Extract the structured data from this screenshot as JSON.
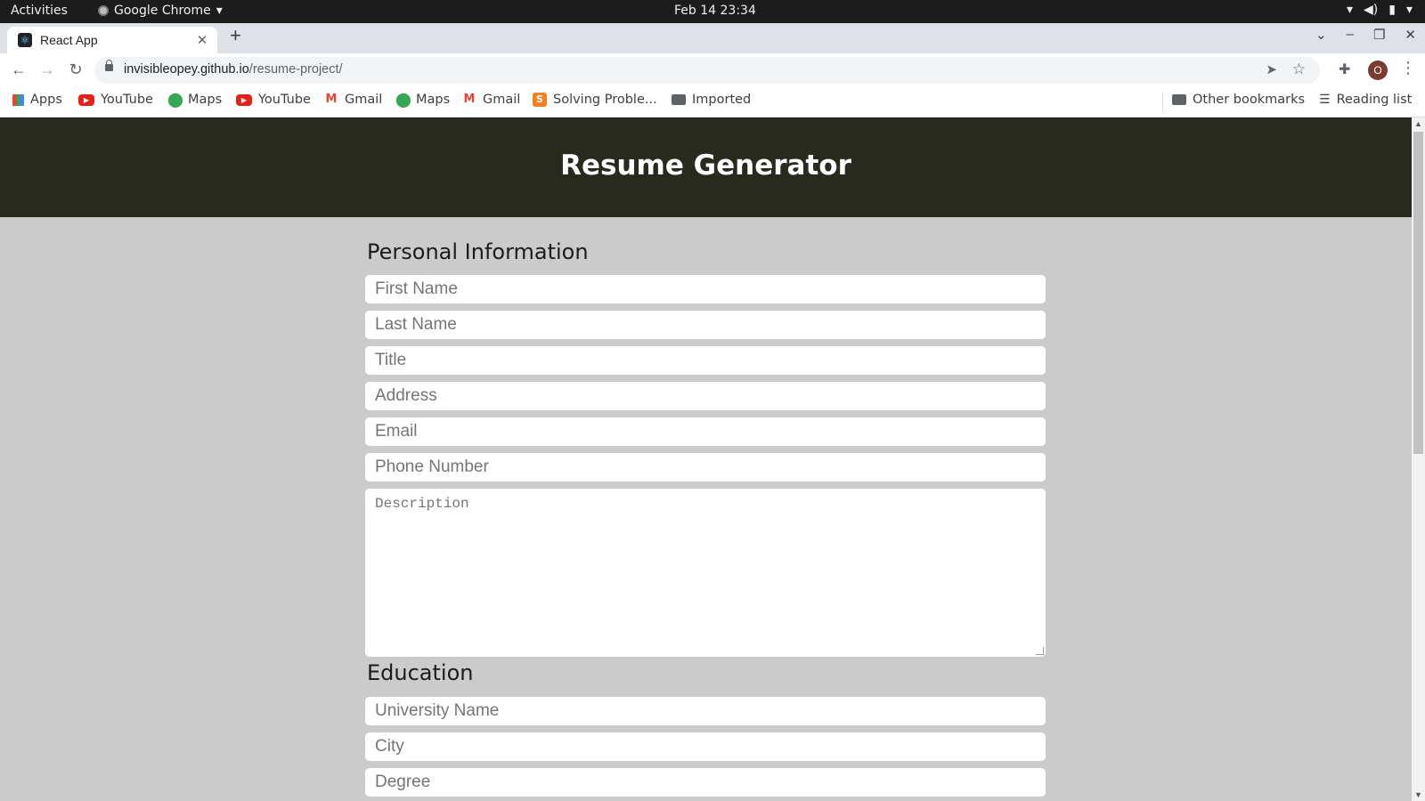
{
  "system": {
    "activities": "Activities",
    "app_name": "Google Chrome",
    "clock": "Feb 14  23:34"
  },
  "browser": {
    "tab_title": "React App",
    "url_host": "invisibleopey.github.io",
    "url_path": "/resume-project/",
    "bookmarks": [
      {
        "label": "Apps",
        "icon": "apps-grid-icon"
      },
      {
        "label": "YouTube",
        "icon": "youtube-icon"
      },
      {
        "label": "Maps",
        "icon": "maps-icon"
      },
      {
        "label": "YouTube",
        "icon": "youtube-icon"
      },
      {
        "label": "Gmail",
        "icon": "gmail-icon"
      },
      {
        "label": "Maps",
        "icon": "maps-icon"
      },
      {
        "label": "Gmail",
        "icon": "gmail-icon"
      },
      {
        "label": "Solving Proble...",
        "icon": "stackoverflow-icon"
      },
      {
        "label": "Imported",
        "icon": "folder-icon"
      }
    ],
    "other_bookmarks": "Other bookmarks",
    "reading_list": "Reading list",
    "avatar_letter": "O"
  },
  "page": {
    "header_title": "Resume Generator",
    "personal": {
      "title": "Personal Information",
      "first_name": "First Name",
      "last_name": "Last Name",
      "job_title": "Title",
      "address": "Address",
      "email": "Email",
      "phone": "Phone Number",
      "description": "Description"
    },
    "education": {
      "title": "Education",
      "university": "University Name",
      "city": "City",
      "degree": "Degree"
    }
  },
  "colors": {
    "header_bg": "#292a1e",
    "page_bg": "#cbcbcb"
  }
}
